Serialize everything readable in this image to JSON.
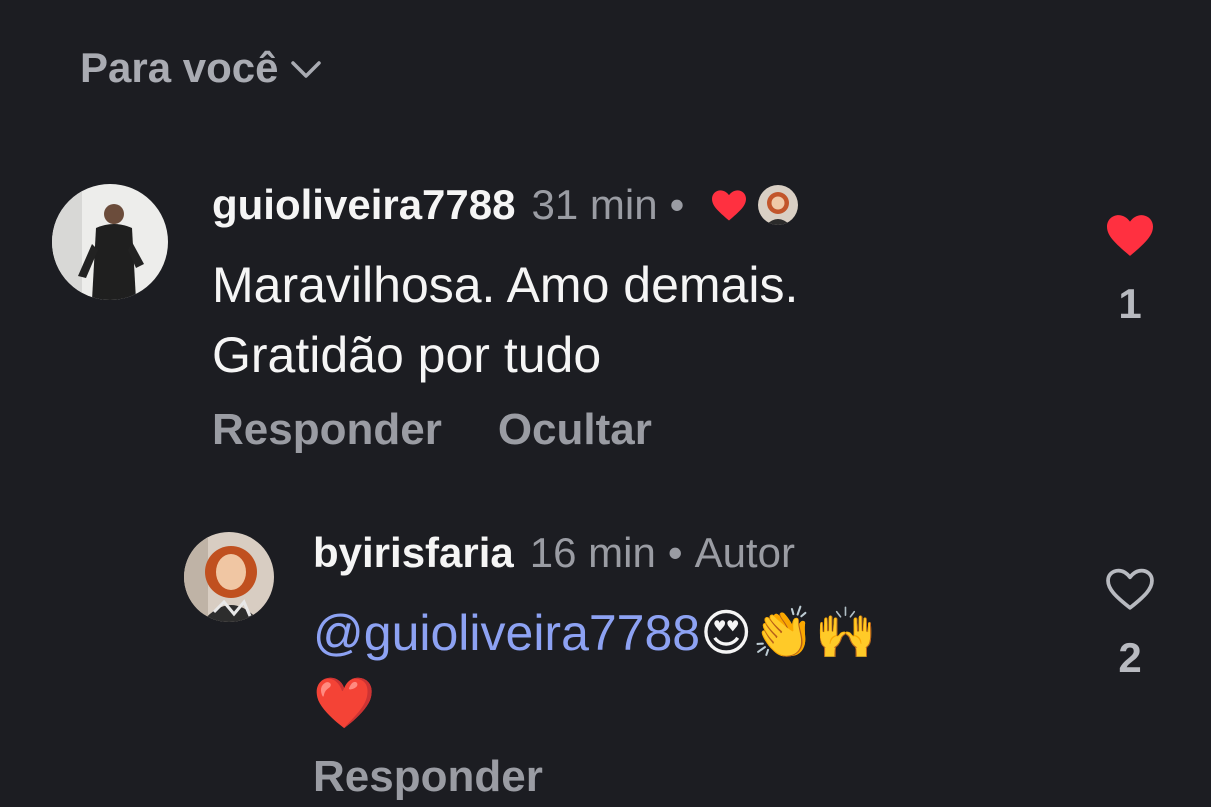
{
  "header": {
    "sort_label": "Para você"
  },
  "comments": [
    {
      "username": "guioliveira7788",
      "time": "31 min",
      "separator": "•",
      "text_line1": "Maravilhosa. Amo demais.",
      "text_line2": "Gratidão por tudo",
      "reply_label": "Responder",
      "hide_label": "Ocultar",
      "like_count": "1",
      "liked": true
    },
    {
      "username": "byirisfaria",
      "time": "16 min",
      "separator": "•",
      "badge": "Autor",
      "mention": "@guioliveira7788",
      "emojis": "😍👏🙌",
      "emoji_line2": "❤️",
      "reply_label": "Responder",
      "like_count": "2",
      "liked": false
    }
  ],
  "colors": {
    "background": "#1c1d22",
    "like_red": "#ff3040",
    "mention_blue": "#8da2f3"
  }
}
